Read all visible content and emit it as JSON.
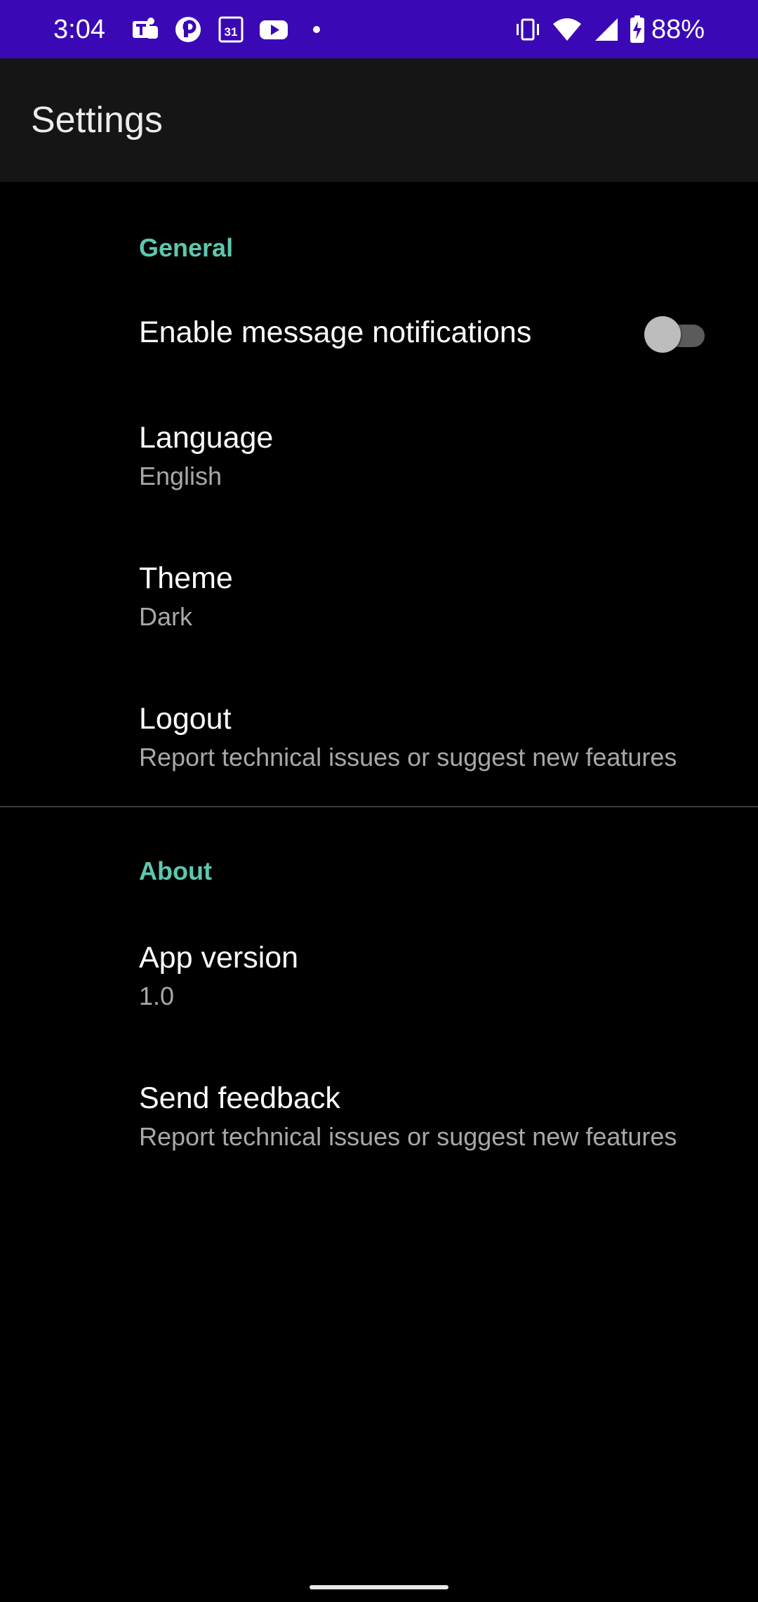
{
  "status_bar": {
    "time": "3:04",
    "background": "#3a09b5",
    "notification_icons": [
      "teams-icon",
      "p-app-icon",
      "calendar-icon",
      "youtube-icon",
      "dot-icon"
    ],
    "calendar_date": "31",
    "system_icons": [
      "vibrate-icon",
      "wifi-icon",
      "signal-icon",
      "battery-charging-icon"
    ],
    "battery_percent": "88%"
  },
  "app_bar": {
    "title": "Settings",
    "background": "#151515"
  },
  "categories": {
    "general": {
      "title": "General",
      "color": "#5cc8ae"
    },
    "about": {
      "title": "About",
      "color": "#5cc8ae"
    }
  },
  "preferences": {
    "notifications": {
      "title": "Enable message notifications",
      "switch_on": false
    },
    "language": {
      "title": "Language",
      "summary": "English"
    },
    "theme": {
      "title": "Theme",
      "summary": "Dark"
    },
    "logout": {
      "title": "Logout",
      "summary": "Report technical issues or suggest new features"
    },
    "app_version": {
      "title": "App version",
      "summary": "1.0"
    },
    "send_feedback": {
      "title": "Send feedback",
      "summary": "Report technical issues or suggest new features"
    }
  }
}
